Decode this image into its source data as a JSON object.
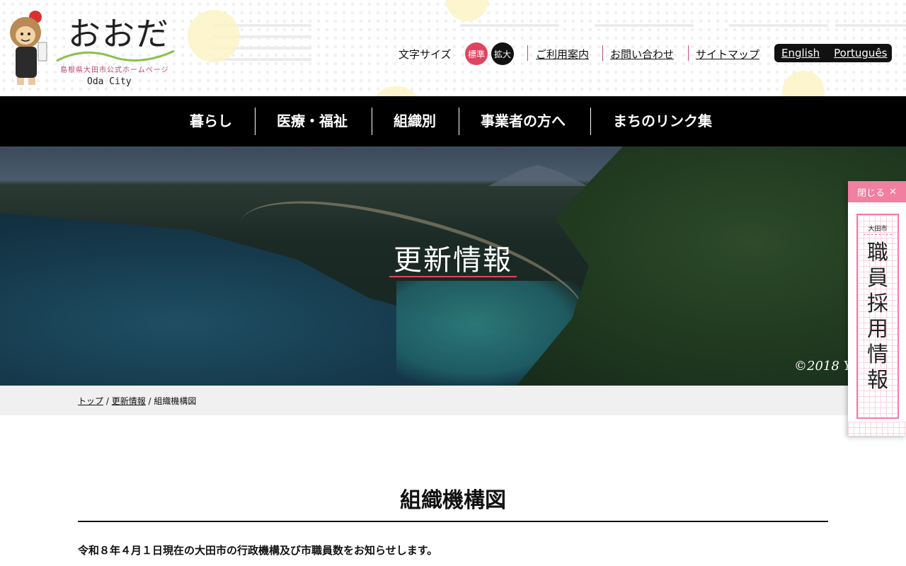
{
  "logo": {
    "title": "おおだ",
    "subtitle": "島根県大田市公式ホームページ",
    "english": "Oda City"
  },
  "header": {
    "fontsize_label": "文字サイズ",
    "fontsize_standard": "標準",
    "fontsize_large": "拡大",
    "links": [
      "ご利用案内",
      "お問い合わせ",
      "サイトマップ"
    ],
    "languages": [
      "English",
      "Português"
    ]
  },
  "nav": {
    "items": [
      "暮らし",
      "医療・福祉",
      "組織別",
      "事業者の方へ",
      "まちのリンク集"
    ]
  },
  "hero": {
    "title": "更新情報",
    "copyright": "©2018 Y"
  },
  "breadcrumb": {
    "items": [
      "トップ",
      "更新情報",
      "組織機構図"
    ],
    "separator": " / "
  },
  "main": {
    "title": "組織機構図",
    "intro": "令和８年４月１日現在の大田市の行政機構及び市職員数をお知らせします。"
  },
  "side_banner": {
    "close_label": "閉じる",
    "close_glyph": "✕",
    "org": "大田市",
    "text": "職\n員\n採\n用\n情\n報"
  },
  "colors": {
    "accent_pink": "#e0455f",
    "banner_pink": "#f07fa0",
    "nav_bg": "#000000"
  }
}
